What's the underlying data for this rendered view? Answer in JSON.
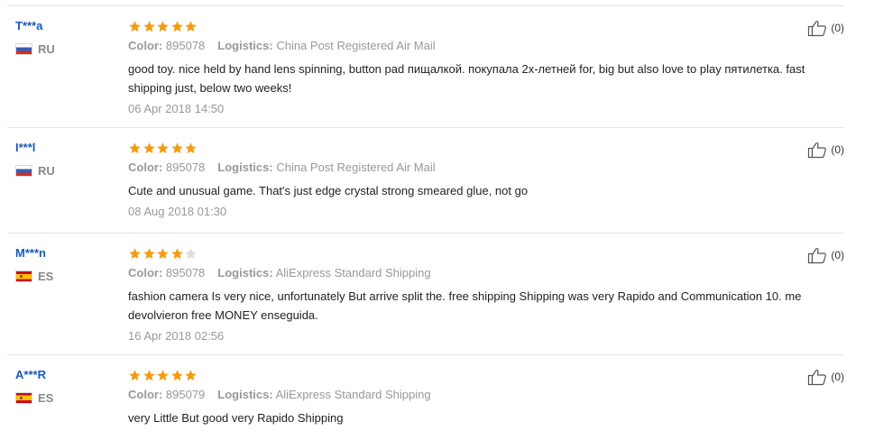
{
  "colors": {
    "star_filled": "#f39c12",
    "star_empty": "#dddddd",
    "username": "#1a5ab8",
    "meta_gray": "#999999"
  },
  "reviews": [
    {
      "user": "T***a",
      "country_code": "RU",
      "flag_icon": "russia-flag-icon",
      "rating": 5,
      "color_label": "Color:",
      "color_value": "895078",
      "logistics_label": "Logistics:",
      "logistics_value": "China Post Registered Air Mail",
      "text": "good toy. nice held by hand lens spinning, button pad пищалкой. покупала 2х-летней for, big but also love to play пятилетка. fast shipping just, below two weeks!",
      "date": "06 Apr 2018 14:50",
      "useful_count": "(0)"
    },
    {
      "user": "I***l",
      "country_code": "RU",
      "flag_icon": "russia-flag-icon",
      "rating": 5,
      "color_label": "Color:",
      "color_value": "895078",
      "logistics_label": "Logistics:",
      "logistics_value": "China Post Registered Air Mail",
      "text": "Cute and unusual game. That's just edge crystal strong smeared glue, not go",
      "date": "08 Aug 2018 01:30",
      "useful_count": "(0)"
    },
    {
      "user": "M***n",
      "country_code": "ES",
      "flag_icon": "spain-flag-icon",
      "rating": 4,
      "color_label": "Color:",
      "color_value": "895078",
      "logistics_label": "Logistics:",
      "logistics_value": "AliExpress Standard Shipping",
      "text": "fashion camera Is very nice, unfortunately But arrive split the. free shipping Shipping was very Rapido and Communication 10. me devolvieron free MONEY enseguida.",
      "date": "16 Apr 2018 02:56",
      "useful_count": "(0)"
    },
    {
      "user": "A***R",
      "country_code": "ES",
      "flag_icon": "spain-flag-icon",
      "rating": 5,
      "color_label": "Color:",
      "color_value": "895079",
      "logistics_label": "Logistics:",
      "logistics_value": "AliExpress Standard Shipping",
      "text": "very Little But good very Rapido Shipping",
      "date": "",
      "useful_count": "(0)"
    }
  ]
}
